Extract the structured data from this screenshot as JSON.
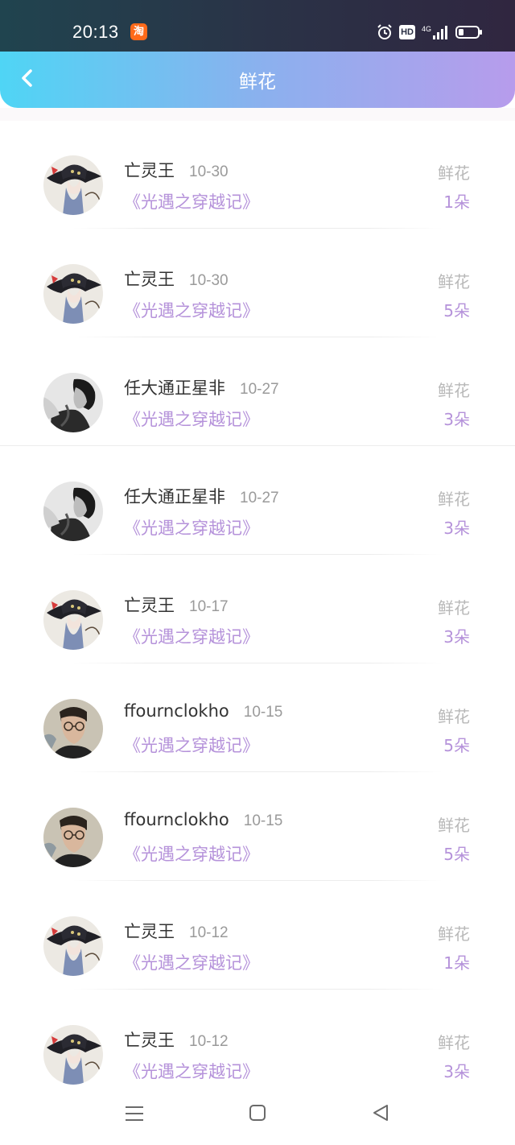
{
  "status_bar": {
    "time": "20:13",
    "app_badge": "淘",
    "hd_label": "HD",
    "network_label": "4G",
    "icons": [
      "taobao-icon",
      "alarm-icon",
      "hd-icon",
      "signal-icon",
      "battery-icon"
    ]
  },
  "header": {
    "title": "鲜花",
    "back_icon": "chevron-left-icon"
  },
  "colors": {
    "header_gradient_start": "#4fd5f5",
    "header_gradient_end": "#b79cec",
    "accent_purple": "#b592da",
    "muted_gray": "#9a9a9a"
  },
  "records": [
    {
      "name": "亡灵王",
      "date": "10-30",
      "book": "《光遇之穿越记》",
      "gift": "鲜花",
      "count": "1朵",
      "avatar": "avatar-hat"
    },
    {
      "name": "亡灵王",
      "date": "10-30",
      "book": "《光遇之穿越记》",
      "gift": "鲜花",
      "count": "5朵",
      "avatar": "avatar-hat"
    },
    {
      "name": "任大通正星非",
      "date": "10-27",
      "book": "《光遇之穿越记》",
      "gift": "鲜花",
      "count": "3朵",
      "avatar": "avatar-bw"
    },
    {
      "name": "任大通正星非",
      "date": "10-27",
      "book": "《光遇之穿越记》",
      "gift": "鲜花",
      "count": "3朵",
      "avatar": "avatar-bw"
    },
    {
      "name": "亡灵王",
      "date": "10-17",
      "book": "《光遇之穿越记》",
      "gift": "鲜花",
      "count": "3朵",
      "avatar": "avatar-hat"
    },
    {
      "name": "ffournclokho",
      "date": "10-15",
      "book": "《光遇之穿越记》",
      "gift": "鲜花",
      "count": "5朵",
      "avatar": "avatar-glasses"
    },
    {
      "name": "ffournclokho",
      "date": "10-15",
      "book": "《光遇之穿越记》",
      "gift": "鲜花",
      "count": "5朵",
      "avatar": "avatar-glasses"
    },
    {
      "name": "亡灵王",
      "date": "10-12",
      "book": "《光遇之穿越记》",
      "gift": "鲜花",
      "count": "1朵",
      "avatar": "avatar-hat"
    },
    {
      "name": "亡灵王",
      "date": "10-12",
      "book": "《光遇之穿越记》",
      "gift": "鲜花",
      "count": "3朵",
      "avatar": "avatar-hat"
    }
  ],
  "nav_bar": {
    "icons": [
      "menu-icon",
      "home-icon",
      "back-triangle-icon"
    ]
  }
}
